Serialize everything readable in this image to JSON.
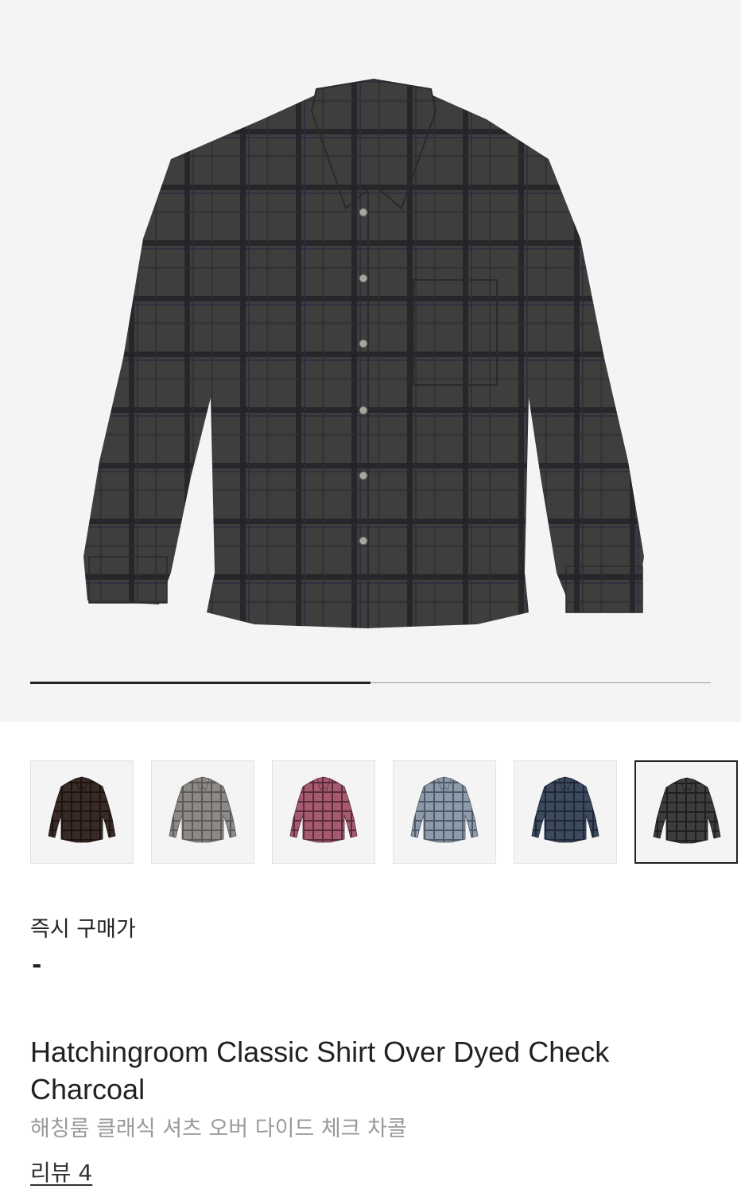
{
  "gallery": {
    "main_image": "charcoal-check-shirt",
    "slide_progress": 0.5,
    "swatches": [
      {
        "name": "brown",
        "color": "#3a2a25",
        "line": "#1c1411"
      },
      {
        "name": "grey",
        "color": "#8c8986",
        "line": "#5c5a58"
      },
      {
        "name": "pink",
        "color": "#a55a70",
        "line": "#5a2c3a"
      },
      {
        "name": "light-blue",
        "color": "#8d9aa9",
        "line": "#4f5a68"
      },
      {
        "name": "navy",
        "color": "#3c4a5e",
        "line": "#1f2735"
      },
      {
        "name": "charcoal",
        "color": "#3d3e3c",
        "line": "#1f1f24",
        "selected": true
      }
    ]
  },
  "price": {
    "label": "즉시 구매가",
    "value": "-"
  },
  "product": {
    "title_en": "Hatchingroom Classic Shirt Over Dyed Check Charcoal",
    "title_ko": "해칭룸 클래식 셔츠 오버 다이드 체크 차콜",
    "review_label": "리뷰 4"
  }
}
